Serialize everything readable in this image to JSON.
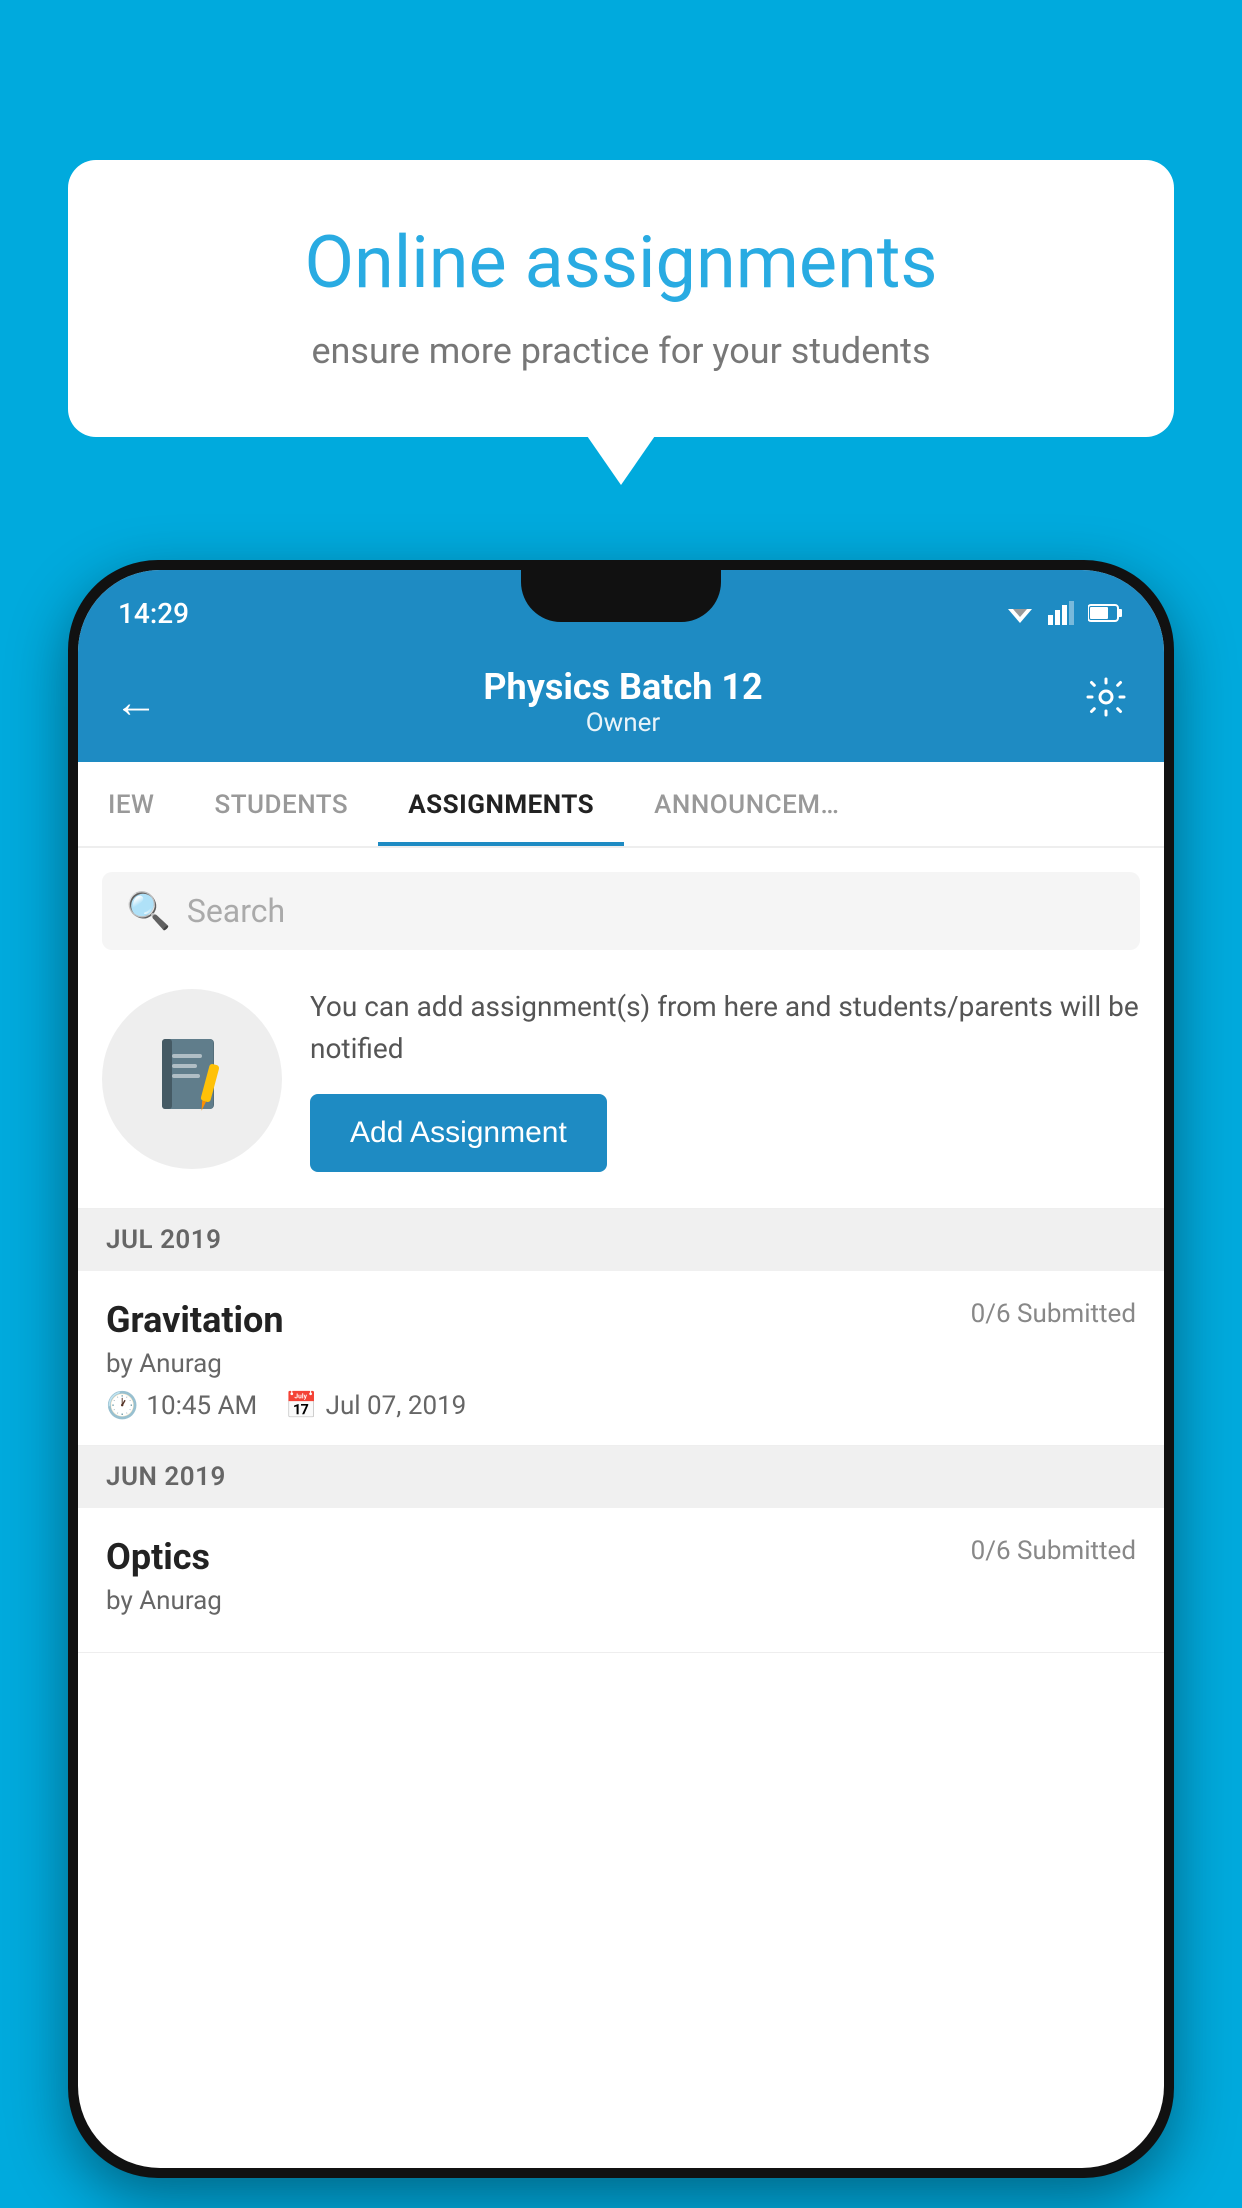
{
  "background": {
    "color": "#00AADD"
  },
  "promo": {
    "title": "Online assignments",
    "subtitle": "ensure more practice for your students"
  },
  "status_bar": {
    "time": "14:29"
  },
  "header": {
    "title": "Physics Batch 12",
    "subtitle": "Owner",
    "back_icon": "←",
    "settings_label": "Settings"
  },
  "tabs": [
    {
      "label": "IEW",
      "active": false
    },
    {
      "label": "STUDENTS",
      "active": false
    },
    {
      "label": "ASSIGNMENTS",
      "active": true
    },
    {
      "label": "ANNOUNCEM…",
      "active": false
    }
  ],
  "search": {
    "placeholder": "Search"
  },
  "assignment_promo": {
    "description": "You can add assignment(s) from here and students/parents will be notified",
    "button_label": "Add Assignment"
  },
  "sections": [
    {
      "header": "JUL 2019",
      "assignments": [
        {
          "title": "Gravitation",
          "submitted": "0/6 Submitted",
          "by": "by Anurag",
          "time": "10:45 AM",
          "date": "Jul 07, 2019"
        }
      ]
    },
    {
      "header": "JUN 2019",
      "assignments": [
        {
          "title": "Optics",
          "submitted": "0/6 Submitted",
          "by": "by Anurag",
          "time": "",
          "date": ""
        }
      ]
    }
  ]
}
